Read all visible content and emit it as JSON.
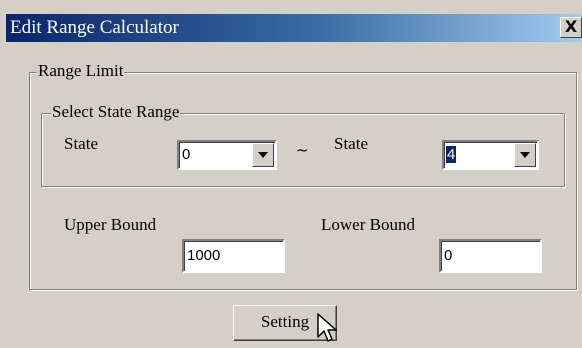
{
  "window": {
    "title": "Edit Range Calculator",
    "close_label": "X"
  },
  "range_limit": {
    "label": "Range Limit",
    "select_state_range": {
      "label": "Select State Range",
      "state_from_label": "State",
      "state_from_value": "0",
      "separator": "~",
      "state_to_label": "State",
      "state_to_value": "4"
    },
    "upper_bound": {
      "label": "Upper Bound",
      "value": "1000"
    },
    "lower_bound": {
      "label": "Lower Bound",
      "value": "0"
    }
  },
  "setting_button_label": "Setting",
  "icons": {
    "close": "close-icon",
    "dropdown": "chevron-down-icon",
    "cursor": "mouse-pointer-icon"
  },
  "colors": {
    "face": "#d4d0c8",
    "titlebar_start": "#0a246a",
    "titlebar_end": "#a6caf0",
    "selection": "#0a246a"
  }
}
